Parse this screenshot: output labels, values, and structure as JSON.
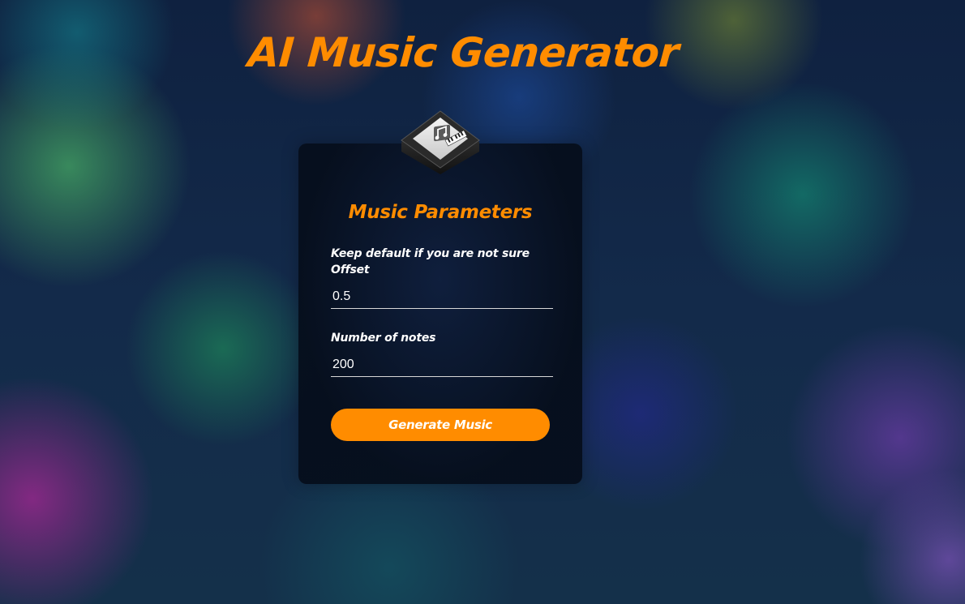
{
  "page": {
    "title": "AI Music Generator"
  },
  "card": {
    "logo_icon": "music-chip-icon",
    "title": "Music Parameters",
    "hint": "Keep default if you are not sure",
    "offset_label": "Offset",
    "offset_value": "0.5",
    "notes_label": "Number of notes",
    "notes_value": "200",
    "generate_label": "Generate Music"
  },
  "colors": {
    "accent": "#ff8c00",
    "card_bg": "#0a1426",
    "text": "#ffffff"
  }
}
